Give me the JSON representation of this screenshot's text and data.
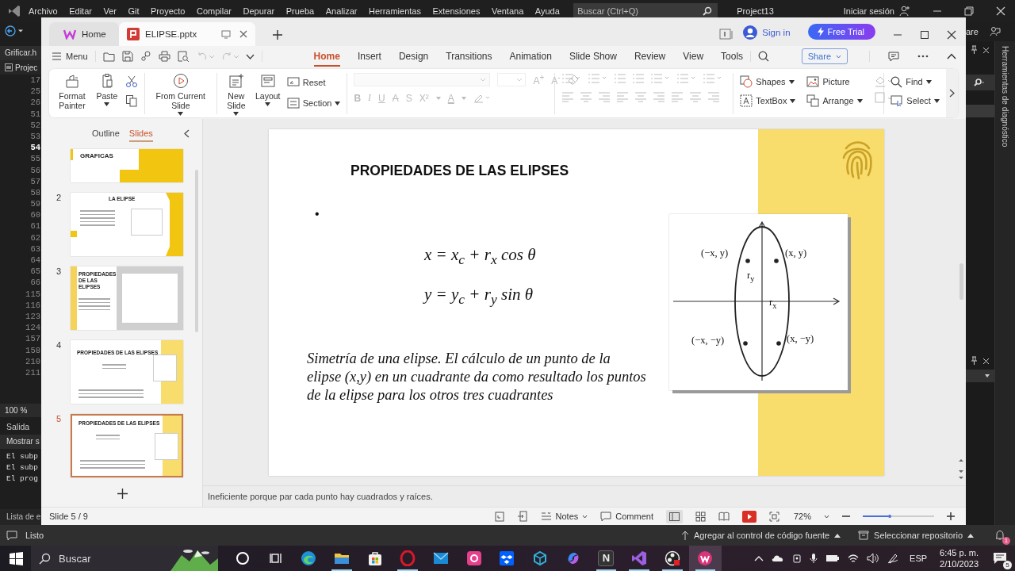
{
  "ide": {
    "menu": [
      "Archivo",
      "Editar",
      "Ver",
      "Git",
      "Proyecto",
      "Compilar",
      "Depurar",
      "Prueba",
      "Analizar",
      "Herramientas",
      "Extensiones",
      "Ventana",
      "Ayuda"
    ],
    "search_placeholder": "Buscar (Ctrl+Q)",
    "project": "Project13",
    "sign_in": "Iniciar sesión",
    "file_tab": "Grificar.h",
    "solution_item": "Projec",
    "line_numbers": [
      {
        "n": "17",
        "current": false
      },
      {
        "n": "25",
        "current": false
      },
      {
        "n": "26",
        "current": false
      },
      {
        "n": "51",
        "current": false
      },
      {
        "n": "52",
        "current": false
      },
      {
        "n": "53",
        "current": false
      },
      {
        "n": "54",
        "current": true
      },
      {
        "n": "55",
        "current": false
      },
      {
        "n": "56",
        "current": false
      },
      {
        "n": "57",
        "current": false
      },
      {
        "n": "58",
        "current": false
      },
      {
        "n": "59",
        "current": false
      },
      {
        "n": "60",
        "current": false
      },
      {
        "n": "61",
        "current": false
      },
      {
        "n": "62",
        "current": false
      },
      {
        "n": "63",
        "current": false
      },
      {
        "n": "64",
        "current": false
      },
      {
        "n": "65",
        "current": false
      },
      {
        "n": "66",
        "current": false
      },
      {
        "n": "115",
        "current": false
      },
      {
        "n": "116",
        "current": false
      },
      {
        "n": "123",
        "current": false
      },
      {
        "n": "124",
        "current": false
      },
      {
        "n": "157",
        "current": false
      },
      {
        "n": "158",
        "current": false
      },
      {
        "n": "210",
        "current": false
      },
      {
        "n": "211",
        "current": false
      }
    ],
    "zoom": "100 %",
    "output": {
      "title": "Salida",
      "show_label": "Mostrar s",
      "lines": [
        "El subp",
        "El subp",
        "El prog"
      ]
    },
    "error_list": "Lista de e",
    "right_panel": {
      "header_text": "are",
      "diagnostics": "Herramientas de diagnóstico"
    },
    "status": {
      "ready": "Listo",
      "source_control": "Agregar al control de código fuente",
      "repository": "Seleccionar repositorio",
      "notifications": "1"
    }
  },
  "wps": {
    "tabs": [
      {
        "label": "Home",
        "selected": false
      },
      {
        "label": "ELIPSE.pptx",
        "selected": true
      }
    ],
    "sign_in": "Sign in",
    "free_trial": "Free Trial",
    "menu": "Menu",
    "undo": {
      "disabled": true
    },
    "redo": {
      "disabled": true
    },
    "ribbon_tabs": [
      {
        "label": "Home",
        "selected": true
      },
      {
        "label": "Insert",
        "selected": false
      },
      {
        "label": "Design",
        "selected": false
      },
      {
        "label": "Transitions",
        "selected": false
      },
      {
        "label": "Animation",
        "selected": false
      },
      {
        "label": "Slide Show",
        "selected": false
      },
      {
        "label": "Review",
        "selected": false
      },
      {
        "label": "View",
        "selected": false
      },
      {
        "label": "Tools",
        "selected": false
      }
    ],
    "share": "Share",
    "ribbon": {
      "format_painter": "Format Painter",
      "paste": "Paste",
      "from_current": "From Current Slide",
      "new_slide": "New Slide",
      "layout": "Layout",
      "reset": "Reset",
      "section": "Section",
      "font_group": {
        "disabled": true,
        "size_buttons": [
          "A$^{+}$",
          "A$^{-}$"
        ],
        "buttons": [
          "B",
          "I",
          "U",
          "A",
          "S",
          "X²",
          "A"
        ]
      },
      "paragraph_group": {
        "disabled": true
      },
      "shapes": "Shapes",
      "picture": "Picture",
      "textbox": "TextBox",
      "arrange": "Arrange",
      "shape_style": {
        "disabled": true
      },
      "find": "Find",
      "select": "Select"
    },
    "panel_tabs": [
      {
        "label": "Outline",
        "selected": false
      },
      {
        "label": "Slides",
        "selected": true
      }
    ],
    "thumbnails": [
      {
        "kind": "cover",
        "title": "GRAFICAS",
        "selected": false
      },
      {
        "kind": "text-figure",
        "number": "2",
        "title": "LA ELIPSE",
        "selected": false
      },
      {
        "kind": "split",
        "number": "3",
        "title": "PROPIEDADES DE LAS ELIPSES",
        "selected": false
      },
      {
        "kind": "formula",
        "number": "4",
        "title": "PROPIEDADES DE LAS ELIPSES",
        "selected": false
      },
      {
        "kind": "current",
        "number": "5",
        "title": "PROPIEDADES DE LAS ELIPSES",
        "selected": true
      }
    ],
    "slide": {
      "title": "PROPIEDADES DE LAS ELIPSES",
      "bullet": "•",
      "equations": [
        "x = x$_{c}$ + r$_{x}$ cos θ",
        "y = y$_{c}$ + r$_{y}$ sin θ"
      ],
      "caption": "Simetría de una elipse. El cálculo de un punto de la elipse (x,y)  en un cuadrante da como resultado los puntos de la elipse para los otros tres cuadrantes",
      "figure_labels": [
        "(−x, y)",
        "(x, y)",
        "r$_{y}$",
        "r$_{x}$",
        "(−x, −y)",
        "(x, −y)"
      ]
    },
    "notes": "Ineficiente porque par cada punto hay cuadrados y raíces.",
    "status": {
      "slide": "Slide 5 / 9",
      "notes": "Notes",
      "comment": "Comment",
      "zoom": "72%",
      "level": 0.35
    }
  },
  "taskbar": {
    "search": "Buscar",
    "app_letter": "N",
    "apps": [
      {
        "running": false,
        "selected": false
      },
      {
        "running": false,
        "selected": false
      },
      {
        "running": false,
        "selected": false
      },
      {
        "running": true,
        "selected": false
      },
      {
        "running": false,
        "selected": false
      },
      {
        "running": true,
        "selected": false
      },
      {
        "running": false,
        "selected": false
      },
      {
        "running": false,
        "selected": false
      },
      {
        "running": false,
        "selected": false
      },
      {
        "running": false,
        "selected": false
      },
      {
        "running": false,
        "selected": false
      },
      {
        "running": true,
        "selected": false
      },
      {
        "running": true,
        "selected": false
      },
      {
        "running": true,
        "selected": false
      },
      {
        "running": true,
        "selected": true
      }
    ],
    "language": "ESP",
    "time": "6:45 p. m.",
    "date": "2/10/2023",
    "notifications": "5"
  }
}
